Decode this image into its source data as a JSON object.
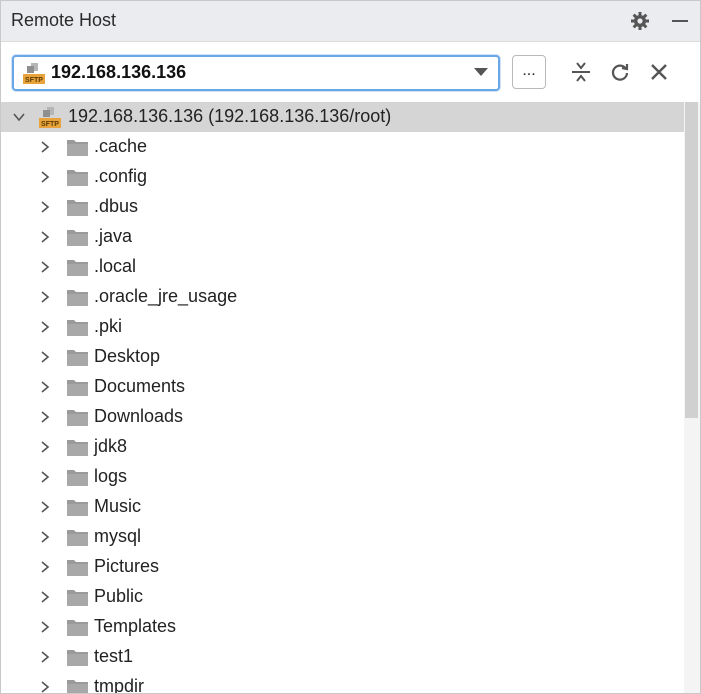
{
  "header": {
    "title": "Remote Host",
    "settings_icon": "gear-icon",
    "minimize_icon": "minimize-icon"
  },
  "toolbar": {
    "host_value": "192.168.136.136",
    "host_type_icon": "sftp-icon",
    "more_label": "...",
    "collapse_icon": "collapse-all-icon",
    "refresh_icon": "refresh-icon",
    "close_icon": "close-icon"
  },
  "tree": {
    "root_label": "192.168.136.136 (192.168.136.136/root)",
    "items": [
      {
        "label": ".cache"
      },
      {
        "label": ".config"
      },
      {
        "label": ".dbus"
      },
      {
        "label": ".java"
      },
      {
        "label": ".local"
      },
      {
        "label": ".oracle_jre_usage"
      },
      {
        "label": ".pki"
      },
      {
        "label": "Desktop"
      },
      {
        "label": "Documents"
      },
      {
        "label": "Downloads"
      },
      {
        "label": "jdk8"
      },
      {
        "label": "logs"
      },
      {
        "label": "Music"
      },
      {
        "label": "mysql"
      },
      {
        "label": "Pictures"
      },
      {
        "label": "Public"
      },
      {
        "label": "Templates"
      },
      {
        "label": "test1"
      },
      {
        "label": "tmpdir"
      }
    ]
  },
  "colors": {
    "header_bg": "#ebecf0",
    "root_row_bg": "#d5d5d5",
    "focus_border": "#6aa7e6",
    "folder": "#9a9a9a",
    "sftp_badge": "#e8a33d"
  }
}
